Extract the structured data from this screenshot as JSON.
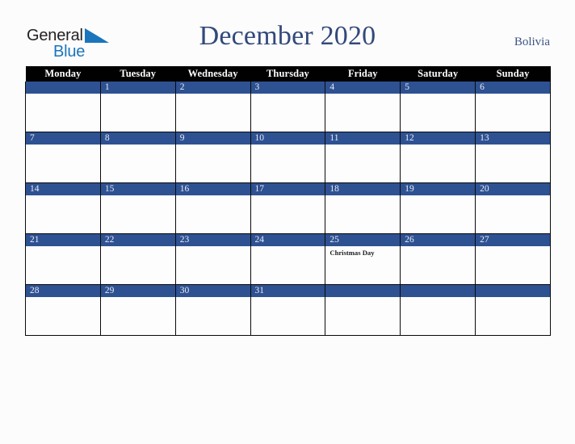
{
  "brand": {
    "logo_word_1": "General",
    "logo_word_2": "Blue",
    "logo_dark_color": "#231f20",
    "logo_blue_color": "#1b75bc",
    "triangle_icon": "triangle-icon"
  },
  "header": {
    "title": "December 2020",
    "month": "December",
    "year": "2020",
    "country": "Bolivia",
    "title_color": "#32497a",
    "country_color": "#3d5584"
  },
  "theme": {
    "accent_blue": "#2e5192",
    "header_bar": "#010101",
    "page_background": "#fcfcfd",
    "cell_background": "#fdfdfd",
    "grid_line": "#0a0a0a",
    "daynum_text": "#e9ecf4"
  },
  "calendar": {
    "weekday_headers": [
      "Monday",
      "Tuesday",
      "Wednesday",
      "Thursday",
      "Friday",
      "Saturday",
      "Sunday"
    ],
    "weeks": [
      [
        {
          "day": "",
          "event": ""
        },
        {
          "day": "1",
          "event": ""
        },
        {
          "day": "2",
          "event": ""
        },
        {
          "day": "3",
          "event": ""
        },
        {
          "day": "4",
          "event": ""
        },
        {
          "day": "5",
          "event": ""
        },
        {
          "day": "6",
          "event": ""
        }
      ],
      [
        {
          "day": "7",
          "event": ""
        },
        {
          "day": "8",
          "event": ""
        },
        {
          "day": "9",
          "event": ""
        },
        {
          "day": "10",
          "event": ""
        },
        {
          "day": "11",
          "event": ""
        },
        {
          "day": "12",
          "event": ""
        },
        {
          "day": "13",
          "event": ""
        }
      ],
      [
        {
          "day": "14",
          "event": ""
        },
        {
          "day": "15",
          "event": ""
        },
        {
          "day": "16",
          "event": ""
        },
        {
          "day": "17",
          "event": ""
        },
        {
          "day": "18",
          "event": ""
        },
        {
          "day": "19",
          "event": ""
        },
        {
          "day": "20",
          "event": ""
        }
      ],
      [
        {
          "day": "21",
          "event": ""
        },
        {
          "day": "22",
          "event": ""
        },
        {
          "day": "23",
          "event": ""
        },
        {
          "day": "24",
          "event": ""
        },
        {
          "day": "25",
          "event": "Christmas Day"
        },
        {
          "day": "26",
          "event": ""
        },
        {
          "day": "27",
          "event": ""
        }
      ],
      [
        {
          "day": "28",
          "event": ""
        },
        {
          "day": "29",
          "event": ""
        },
        {
          "day": "30",
          "event": ""
        },
        {
          "day": "31",
          "event": ""
        },
        {
          "day": "",
          "event": ""
        },
        {
          "day": "",
          "event": ""
        },
        {
          "day": "",
          "event": ""
        }
      ]
    ]
  }
}
